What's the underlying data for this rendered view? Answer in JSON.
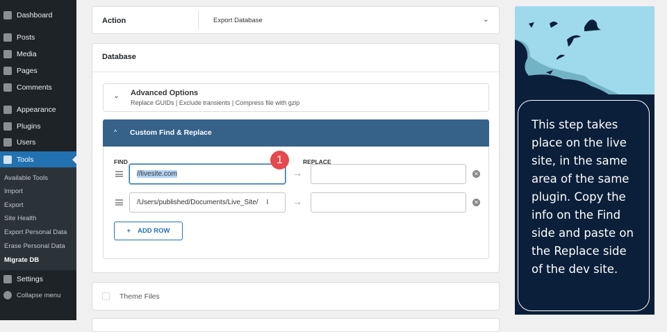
{
  "sidebar": {
    "items": [
      {
        "label": "Dashboard",
        "icon": "dashboard-icon"
      },
      {
        "label": "Posts",
        "icon": "pin-icon"
      },
      {
        "label": "Media",
        "icon": "media-icon"
      },
      {
        "label": "Pages",
        "icon": "pages-icon"
      },
      {
        "label": "Comments",
        "icon": "comment-icon"
      },
      {
        "label": "Appearance",
        "icon": "brush-icon"
      },
      {
        "label": "Plugins",
        "icon": "plugin-icon"
      },
      {
        "label": "Users",
        "icon": "user-icon"
      },
      {
        "label": "Tools",
        "icon": "wrench-icon"
      },
      {
        "label": "Settings",
        "icon": "settings-icon"
      },
      {
        "label": "Collapse menu",
        "icon": "collapse-icon"
      }
    ],
    "submenu": [
      "Available Tools",
      "Import",
      "Export",
      "Site Health",
      "Export Personal Data",
      "Erase Personal Data",
      "Migrate DB"
    ]
  },
  "action": {
    "label": "Action",
    "value": "Export Database"
  },
  "database": {
    "title": "Database",
    "advanced": {
      "title": "Advanced Options",
      "subtitle": "Replace GUIDs | Exclude transients | Compress file with gzip"
    },
    "find_replace": {
      "title": "Custom Find & Replace",
      "find_label": "FIND",
      "replace_label": "REPLACE",
      "rows": [
        {
          "find": "//livesite.com",
          "replace": ""
        },
        {
          "find": "/Users/published/Documents/Live_Site/",
          "replace": ""
        }
      ],
      "add_row": "ADD ROW",
      "badge": "1"
    }
  },
  "theme_files": "Theme Files",
  "callout": {
    "text": "This step takes place on the live site, in the same area of the same plugin. Copy the info on the Find side and paste on the Replace side of the dev site."
  },
  "colors": {
    "accent": "#2271b1",
    "panel_header": "#36628a",
    "badge": "#e5484d",
    "callout_bg": "#0b1f3a",
    "sky": "#9edaec"
  }
}
